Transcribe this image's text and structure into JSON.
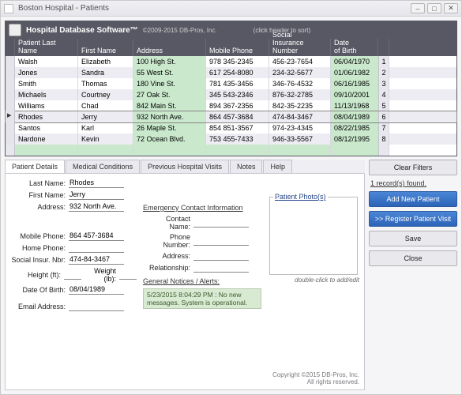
{
  "window": {
    "title": "Boston Hospital - Patients",
    "min": "–",
    "max": "□",
    "close": "✕"
  },
  "header": {
    "app": "Hospital Database Software™",
    "copyright": "©2009-2015 DB-Pros, Inc.",
    "sort_hint": "(click header to sort)"
  },
  "columns": {
    "ln": "Patient Last Name",
    "fn": "First Name",
    "ad": "Address",
    "mp": "Mobile Phone",
    "ssn": "Social\nInsurance\nNumber",
    "dob": "Date\nof Birth"
  },
  "rows": [
    {
      "ln": "Walsh",
      "fn": "Elizabeth",
      "ad": "100 High St.",
      "mp": "978 345-2345",
      "ssn": "456-23-7654",
      "dob": "06/04/1970",
      "n": "1"
    },
    {
      "ln": "Jones",
      "fn": "Sandra",
      "ad": "55 West St.",
      "mp": "617 254-8080",
      "ssn": "234-32-5677",
      "dob": "01/06/1982",
      "n": "2"
    },
    {
      "ln": "Smith",
      "fn": "Thomas",
      "ad": "180 Vine St.",
      "mp": "781 435-3456",
      "ssn": "346-76-4532",
      "dob": "06/16/1985",
      "n": "3"
    },
    {
      "ln": "Michaels",
      "fn": "Courtney",
      "ad": "27 Oak St.",
      "mp": "345 543-2346",
      "ssn": "876-32-2785",
      "dob": "09/10/2001",
      "n": "4"
    },
    {
      "ln": "Williams",
      "fn": "Chad",
      "ad": "842 Main St.",
      "mp": "894 367-2356",
      "ssn": "842-35-2235",
      "dob": "11/13/1968",
      "n": "5"
    },
    {
      "ln": "Rhodes",
      "fn": "Jerry",
      "ad": "932 North Ave.",
      "mp": "864 457-3684",
      "ssn": "474-84-3467",
      "dob": "08/04/1989",
      "n": "6"
    },
    {
      "ln": "Santos",
      "fn": "Karl",
      "ad": "26 Maple St.",
      "mp": "854 851-3567",
      "ssn": "974-23-4345",
      "dob": "08/22/1985",
      "n": "7"
    },
    {
      "ln": "Nardone",
      "fn": "Kevin",
      "ad": "72 Ocean Blvd.",
      "mp": "753 455-7433",
      "ssn": "946-33-5567",
      "dob": "08/12/1995",
      "n": "8"
    }
  ],
  "tabs": [
    "Patient Details",
    "Medical Conditions",
    "Previous Hospital Visits",
    "Notes",
    "Help"
  ],
  "form": {
    "labels": {
      "last": "Last Name:",
      "first": "First Name:",
      "addr": "Address:",
      "mobile": "Mobile Phone:",
      "home": "Home Phone:",
      "ssn": "Social Insur. Nbr:",
      "height": "Height (ft):",
      "weight": "Weight (lb):",
      "dob": "Date Of Birth:",
      "email": "Email Address:",
      "contact": "Contact Name:",
      "phone": "Phone Number:",
      "addr2": "Address:",
      "rel": "Relationship:"
    },
    "sections": {
      "emerg": "Emergency Contact Information",
      "photos": "Patient Photo(s)",
      "notices": "General Notices / Alerts:",
      "photo_cap": "double-click to add/edit"
    },
    "values": {
      "last": "Rhodes",
      "first": "Jerry",
      "addr": "932 North Ave.",
      "mobile": "864 457-3684",
      "home": "",
      "ssn": "474-84-3467",
      "height": "",
      "weight": "",
      "dob": "08/04/1989",
      "email": "",
      "contact": "",
      "phone": "",
      "addr2": "",
      "rel": ""
    },
    "notice": "5/23/2015 8:04:29 PM : No new messages. System is operational."
  },
  "buttons": {
    "clear": "Clear Filters",
    "found": "1 record(s) found.",
    "add": "Add New Patient",
    "reg": ">> Register Patient Visit",
    "save": "Save",
    "close": "Close"
  },
  "footer": {
    "l1": "Copyright ©2015 DB-Pros, Inc.",
    "l2": "All rights reserved."
  }
}
